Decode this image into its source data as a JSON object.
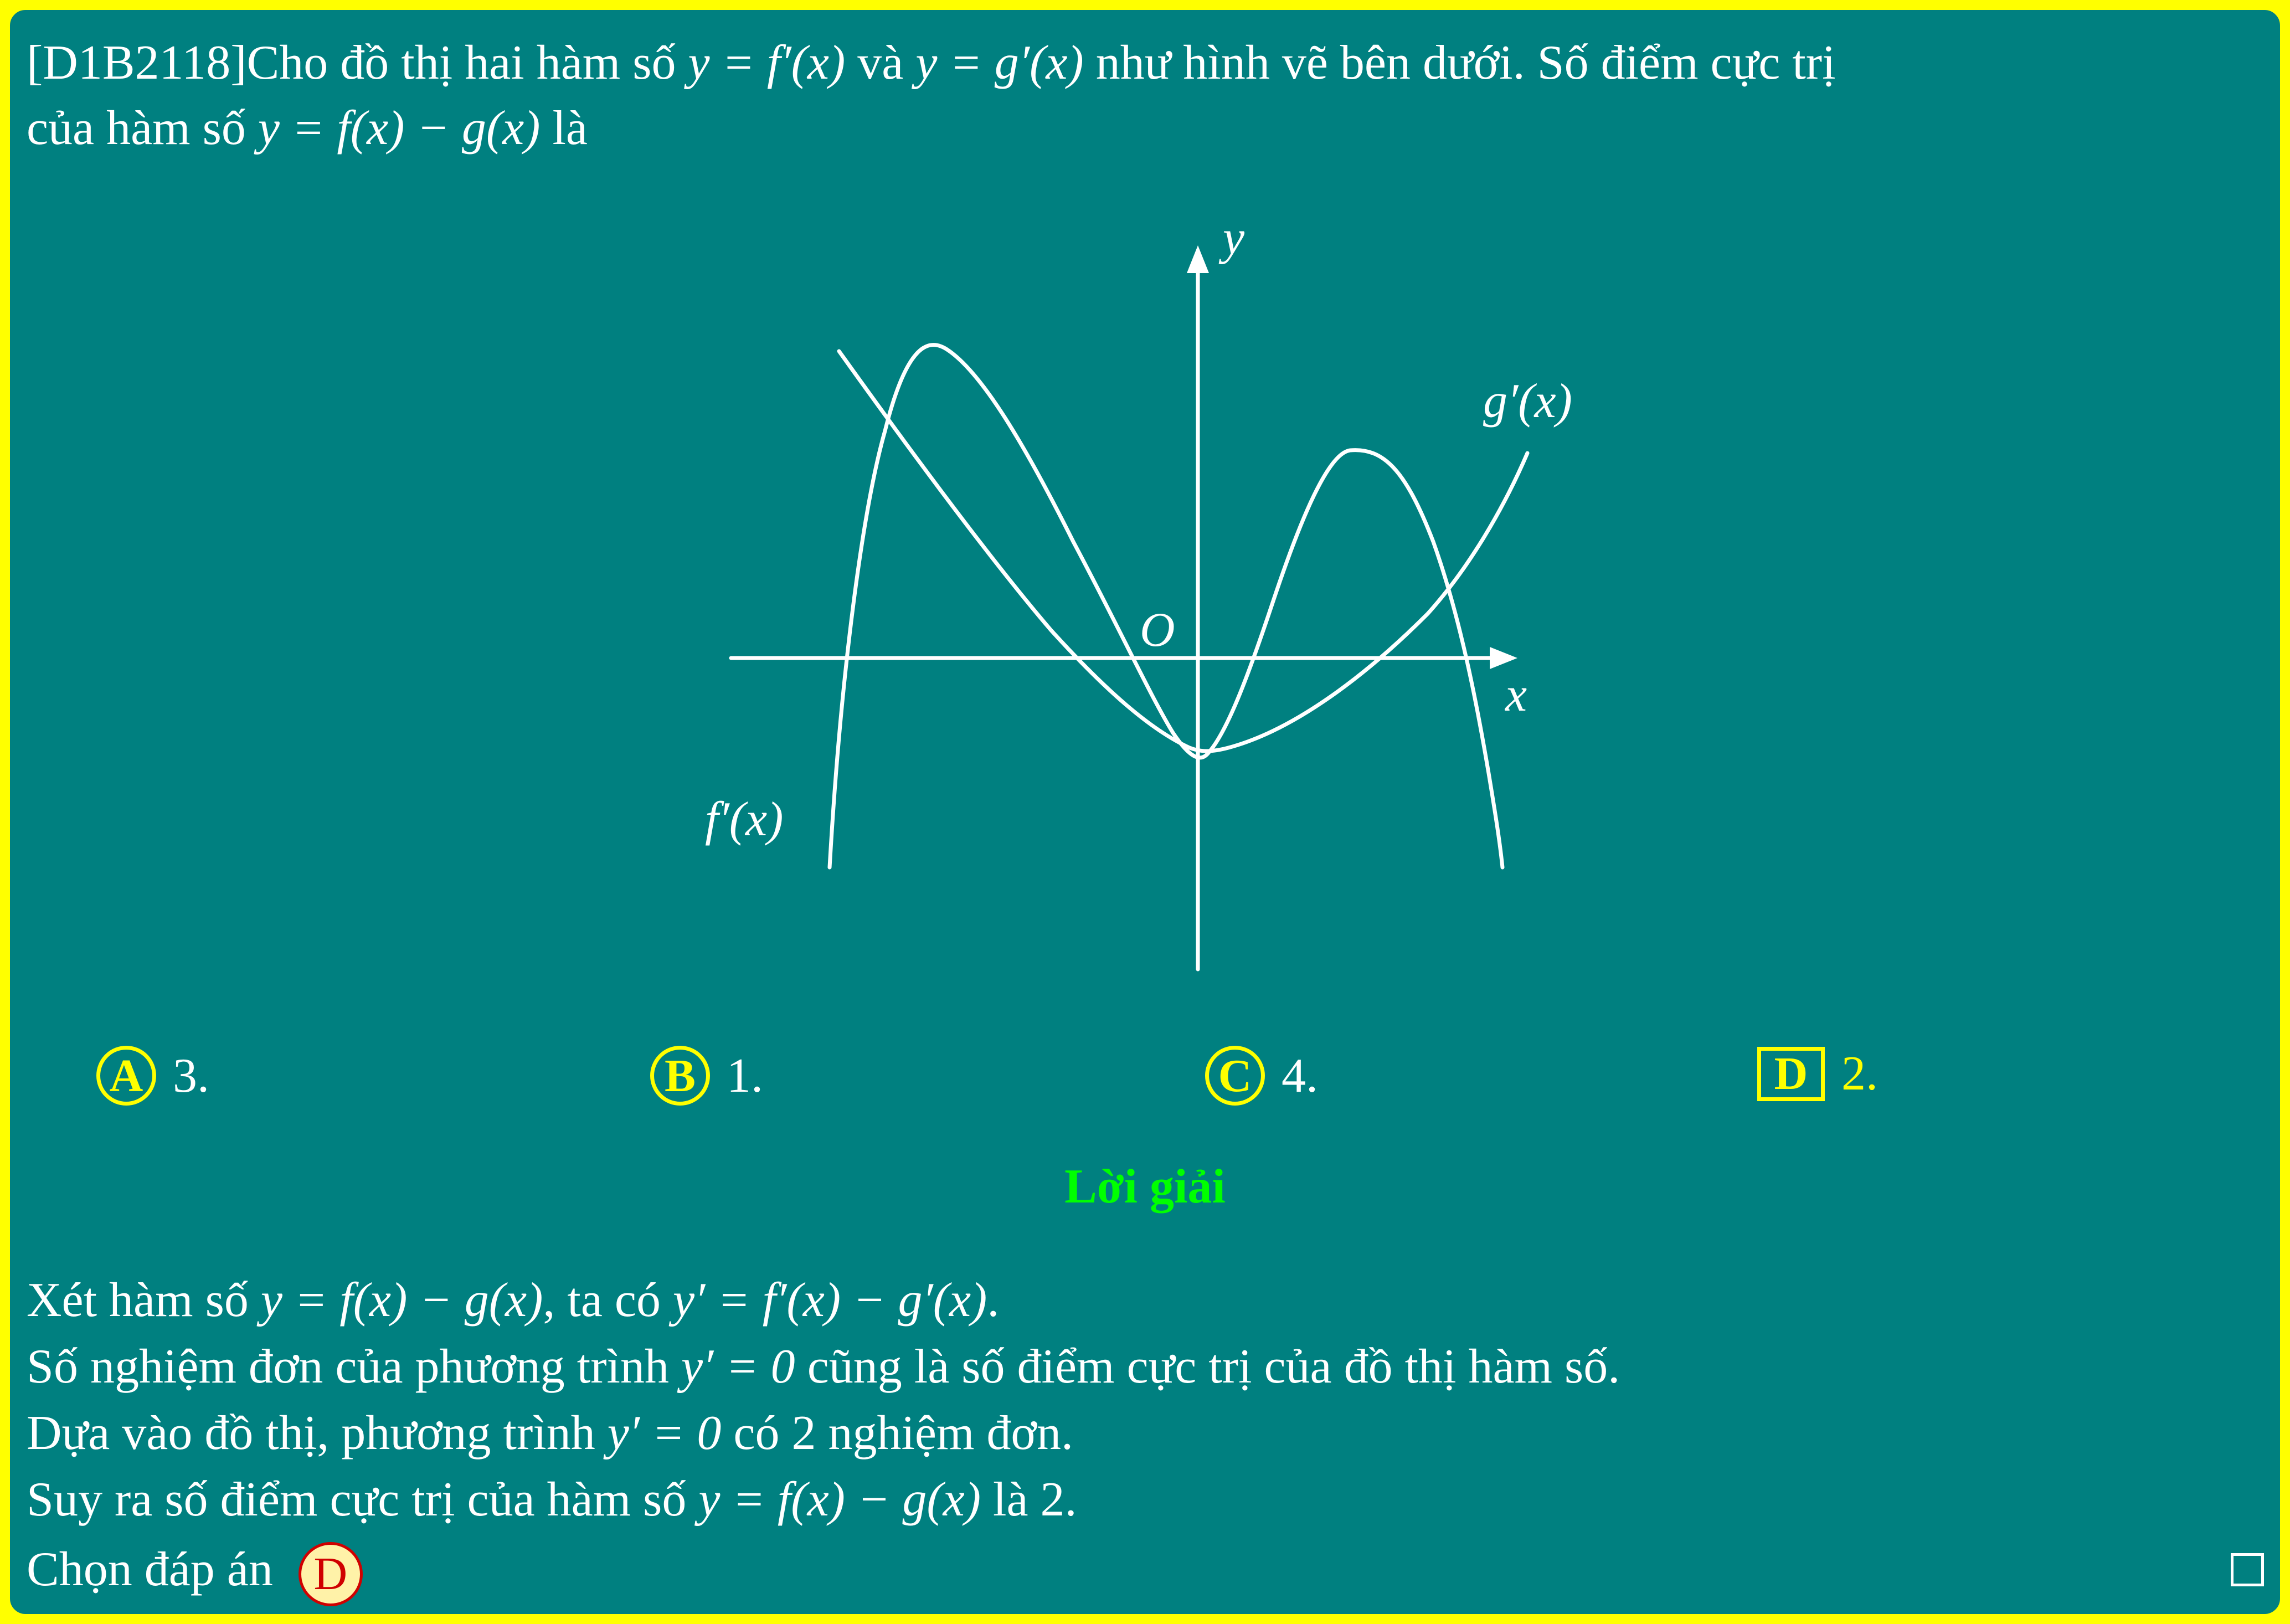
{
  "question": {
    "line1": {
      "id": "[D1B2118]",
      "text1": "Cho đồ thị hai hàm số ",
      "math1": "y = f′(x)",
      "text2": " và ",
      "math2": "y = g′(x)",
      "text3": " như hình vẽ bên dưới. Số điểm cực trị"
    },
    "line2": {
      "text1": "của hàm số ",
      "math1": "y = f(x) − g(x)",
      "text2": " là"
    }
  },
  "graph": {
    "y_label": "y",
    "x_label": "x",
    "origin_label": "O",
    "f_label": "f′(x)",
    "g_label": "g′(x)",
    "stroke_color": "#ffffff"
  },
  "choices": [
    {
      "letter": "A",
      "value": "3.",
      "style": "circle",
      "value_color": "#ffffff"
    },
    {
      "letter": "B",
      "value": "1.",
      "style": "circle",
      "value_color": "#ffffff"
    },
    {
      "letter": "C",
      "value": "4.",
      "style": "circle",
      "value_color": "#ffffff"
    },
    {
      "letter": "D",
      "value": "2.",
      "style": "box",
      "value_color": "#ffff00"
    }
  ],
  "solution": {
    "title": "Lời giải",
    "line1": {
      "t1": "Xét hàm số ",
      "m1": "y = f(x) − g(x)",
      "t2": ", ta có ",
      "m2": "y′ = f′(x) − g′(x)",
      "t3": "."
    },
    "line2": {
      "t1": "Số nghiệm đơn của phương trình ",
      "m1": "y′ = 0",
      "t2": " cũng là số điểm cực trị của đồ thị hàm số."
    },
    "line3": {
      "t1": "Dựa vào đồ thị, phương trình ",
      "m1": "y′ = 0",
      "t2": " có 2 nghiệm đơn."
    },
    "line4": {
      "t1": "Suy ra số điểm cực trị của hàm số ",
      "m1": "y = f(x) − g(x)",
      "t2": " là 2."
    },
    "line5": {
      "t1": "Chọn đáp án ",
      "answer": "D"
    }
  },
  "colors": {
    "background": "#008080",
    "frame": "#ffff00",
    "heading": "#00ff00",
    "answer_fill": "#fff2a8",
    "answer_text": "#d00000"
  }
}
